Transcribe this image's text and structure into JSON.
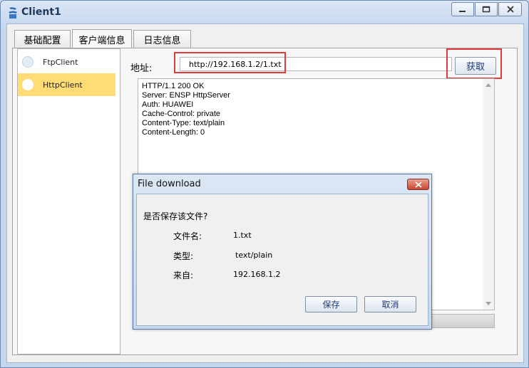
{
  "window": {
    "title": "Client1"
  },
  "tabs": [
    {
      "label": "基础配置"
    },
    {
      "label": "客户端信息"
    },
    {
      "label": "日志信息"
    }
  ],
  "sidebar": {
    "items": [
      {
        "label": "FtpClient"
      },
      {
        "label": "HttpClient"
      }
    ]
  },
  "address": {
    "label": "地址:",
    "value": "http://192.168.1.2/1.txt",
    "button": "获取"
  },
  "response": {
    "lines": "HTTP/1.1 200 OK\nServer: ENSP HttpServer\nAuth: HUAWEI\nCache-Control: private\nContent-Type: text/plain\nContent-Length: 0"
  },
  "dialog": {
    "title": "File download",
    "question": "是否保存该文件?",
    "filename_label": "文件名:",
    "filename_value": "1.txt",
    "type_label": "类型:",
    "type_value": "text/plain",
    "from_label": "来自:",
    "from_value": "192.168.1.2",
    "save_button": "保存",
    "cancel_button": "取消"
  },
  "colors": {
    "highlight": "#e03b3b",
    "selected_item": "#ffdc74"
  }
}
